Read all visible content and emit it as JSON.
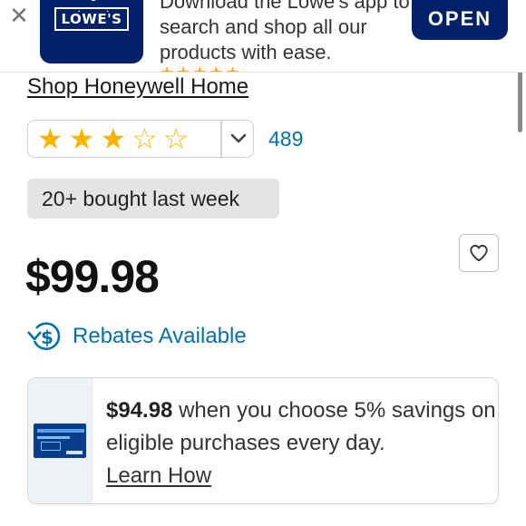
{
  "banner": {
    "close_icon": "close-icon",
    "logo_text": "LOWE'S",
    "message": "Download the Lowe's app to search and shop all our products with ease.",
    "rating_stars": "★★★★★",
    "open_label": "OPEN",
    "colors": {
      "brand": "#012169"
    }
  },
  "product": {
    "brand_link": "Shop Honeywell Home",
    "rating": {
      "value": 3,
      "max": 5,
      "review_count": "489",
      "chevron_icon": "chevron-down-icon"
    },
    "bought_badge": "20+ bought last week",
    "price": "$99.98",
    "favorite_icon": "heart-icon",
    "rebates_label": "Rebates Available",
    "rebates_icon": "rebate-dollar-icon"
  },
  "savings_card": {
    "amount": "$94.98",
    "text": " when you choose 5% savings on eligible purchases every day.",
    "learn_label": "Learn How",
    "card_icon": "credit-card-icon"
  },
  "colors": {
    "link_blue": "#0471af",
    "star_gold": "#f7b500",
    "badge_gray": "#e4e4e4"
  }
}
